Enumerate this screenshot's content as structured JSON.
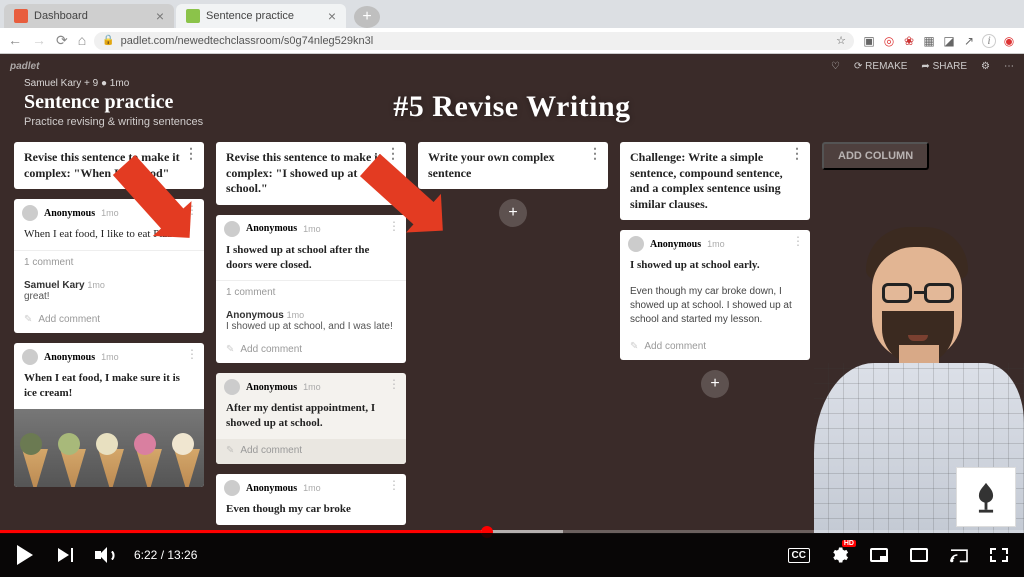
{
  "browser": {
    "tabs": [
      {
        "label": "Dashboard"
      },
      {
        "label": "Sentence practice"
      }
    ],
    "url": "padlet.com/newedtechclassroom/s0g74nleg529kn3l"
  },
  "padlet": {
    "logo": "padlet",
    "actions": {
      "like": "♡",
      "remake": "⟳ REMAKE",
      "share": "➦ SHARE",
      "settings": "⚙",
      "more": "⋯"
    }
  },
  "board": {
    "author": "Samuel Kary",
    "stats": " + 9 ● 1mo",
    "title": "Sentence practice",
    "subtitle": "Practice revising & writing sentences",
    "add_column": "ADD COLUMN"
  },
  "overlay": {
    "title": "#5 Revise Writing"
  },
  "columns": [
    {
      "header": "Revise this sentence to make it complex: \"When I eat food\"",
      "cards": [
        {
          "author": "Anonymous",
          "time": "1mo",
          "body": "When I eat food, I like to eat Pizza.",
          "comments_label": "1 comment",
          "comment_author": "Samuel Kary",
          "comment_time": "1mo",
          "comment_text": "great!",
          "add": "Add comment"
        },
        {
          "author": "Anonymous",
          "time": "1mo",
          "body": "When I eat food, I make sure it is ice cream!"
        }
      ]
    },
    {
      "header": "Revise this sentence to make it complex: \"I showed up at school.\"",
      "cards": [
        {
          "author": "Anonymous",
          "time": "1mo",
          "body": "I showed up at school after the doors were closed.",
          "comments_label": "1 comment",
          "comment_author": "Anonymous",
          "comment_time": "1mo",
          "comment_text": "I showed up at school, and I was late!",
          "add": "Add comment"
        },
        {
          "author": "Anonymous",
          "time": "1mo",
          "body": "After my dentist appointment, I showed up at school.",
          "add": "Add comment"
        },
        {
          "author": "Anonymous",
          "time": "1mo",
          "body": "Even though my car broke"
        }
      ]
    },
    {
      "header": "Write your own complex sentence",
      "cards": []
    },
    {
      "header": "Challenge: Write a simple sentence, compound sentence, and a complex sentence using similar clauses.",
      "cards": [
        {
          "author": "Anonymous",
          "time": "1mo",
          "body": "I showed up at school early.",
          "sub": "Even though my car broke down, I showed up at school.\nI showed up at school and started my lesson.",
          "add": "Add comment"
        }
      ]
    }
  ],
  "video": {
    "time": "6:22 / 13:26",
    "cc": "CC",
    "hd": "HD"
  }
}
